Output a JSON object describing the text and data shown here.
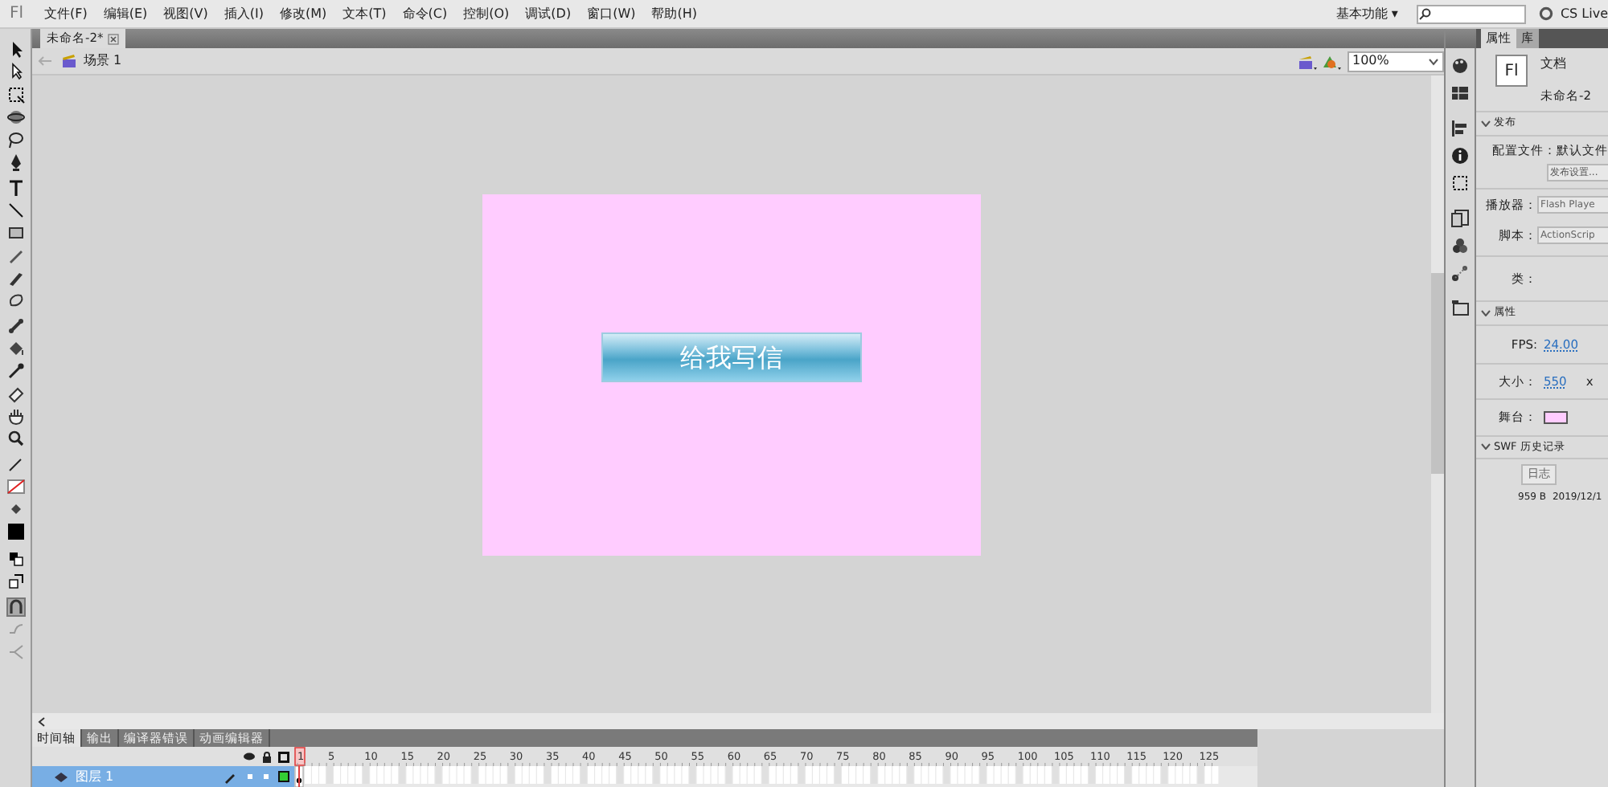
{
  "app_logo": "Fl",
  "menu": [
    "文件(F)",
    "编辑(E)",
    "视图(V)",
    "插入(I)",
    "修改(M)",
    "文本(T)",
    "命令(C)",
    "控制(O)",
    "调试(D)",
    "窗口(W)",
    "帮助(H)"
  ],
  "workspace": {
    "label": "基本功能",
    "caret": "▾"
  },
  "cs_live": "CS Live",
  "document_tab": {
    "title": "未命名-2*"
  },
  "scene": "场景 1",
  "zoom": "100%",
  "stage": {
    "color": "#ffccff",
    "button_text": "给我写信"
  },
  "timeline": {
    "tabs": [
      {
        "label": "时间轴",
        "selected": true
      },
      {
        "label": "输出",
        "selected": false
      },
      {
        "label": "编译器错误",
        "selected": false
      },
      {
        "label": "动画编辑器",
        "selected": false
      }
    ],
    "ruler": [
      "1",
      "5",
      "10",
      "15",
      "20",
      "25",
      "30",
      "35",
      "40",
      "45",
      "50",
      "55",
      "60",
      "65",
      "70",
      "75",
      "80",
      "85",
      "90",
      "95",
      "100",
      "105",
      "110",
      "115",
      "120",
      "125"
    ],
    "layers": [
      {
        "name": "图层 1",
        "selected": true
      }
    ]
  },
  "properties": {
    "tabs": [
      {
        "label": "属性",
        "selected": true
      },
      {
        "label": "库",
        "selected": false
      }
    ],
    "doc_logo": "Fl",
    "doc_type": "文档",
    "doc_name": "未命名-2",
    "publish": {
      "title": "发布",
      "profile_label": "配置文件：",
      "profile_value": "默认文件",
      "settings_button": "发布设置...",
      "player_label": "播放器：",
      "player_value": "Flash Playe",
      "script_label": "脚本：",
      "script_value": "ActionScrip",
      "class_label": "类："
    },
    "props": {
      "title": "属性",
      "fps_label": "FPS:",
      "fps_value": "24.00",
      "size_label": "大小：",
      "size_value": "550",
      "size_x": "x",
      "stage_label": "舞台："
    },
    "swf": {
      "title": "SWF 历史记录",
      "log_button": "日志",
      "size": "959 B",
      "date": "2019/12/1"
    }
  }
}
